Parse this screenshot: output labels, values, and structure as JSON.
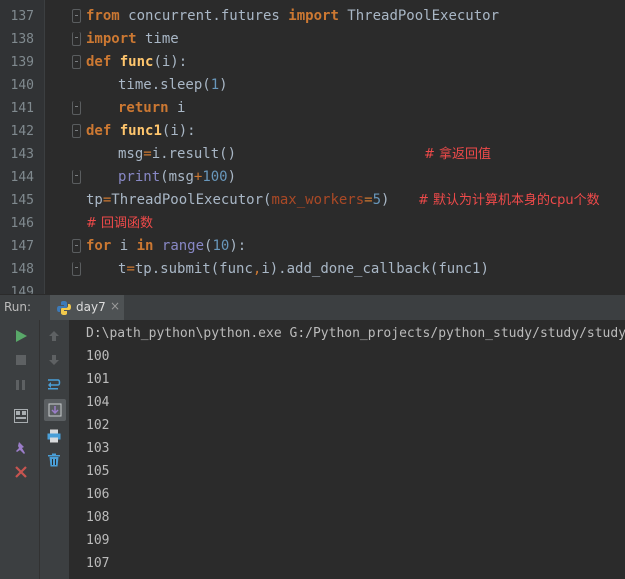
{
  "editor": {
    "lines": [
      {
        "num": "137"
      },
      {
        "num": "138"
      },
      {
        "num": "139"
      },
      {
        "num": "140"
      },
      {
        "num": "141"
      },
      {
        "num": "142"
      },
      {
        "num": "143"
      },
      {
        "num": "144"
      },
      {
        "num": "145"
      },
      {
        "num": "146"
      },
      {
        "num": "147"
      },
      {
        "num": "148"
      },
      {
        "num": "149"
      }
    ],
    "tokens": {
      "l137": [
        "from",
        " concurrent.futures ",
        "import",
        " ThreadPoolExecutor"
      ],
      "l138": [
        "import",
        " time"
      ],
      "l139": [
        "def",
        " ",
        "func",
        "(i):"
      ],
      "l140": [
        "time.sleep(",
        "1",
        ")"
      ],
      "l141": [
        "return",
        " i"
      ],
      "l142": [
        "def",
        " ",
        "func1",
        "(i):"
      ],
      "l143": [
        "msg",
        "=",
        "i.result()",
        "# 拿返回值"
      ],
      "l144": [
        "print",
        "(msg",
        "+",
        "100",
        ")"
      ],
      "l145": [
        "tp",
        "=",
        "ThreadPoolExecutor(",
        "max_workers",
        "=",
        "5",
        ")",
        "# 默认为计算机本身的cpu个数"
      ],
      "l146": [
        "# 回调函数"
      ],
      "l147": [
        "for",
        " i ",
        "in",
        " ",
        "range",
        "(",
        "10",
        "):"
      ],
      "l148": [
        "t",
        "=",
        "tp.submit(func",
        ",",
        "i).add_done_callback(func1)"
      ]
    }
  },
  "run": {
    "label": "Run:",
    "tab_name": "day7",
    "tab_close": "×"
  },
  "console": {
    "command": "D:\\path_python\\python.exe G:/Python_projects/python_study/study/study",
    "outputs": [
      "100",
      "101",
      "104",
      "102",
      "103",
      "105",
      "106",
      "108",
      "109",
      "107"
    ]
  },
  "colors": {
    "keyword": "#cc7832",
    "function": "#ffc66d",
    "number": "#6897bb",
    "builtin": "#8888c6",
    "comment": "#ef4a4a",
    "run_green": "#59a869",
    "close_red": "#c75450"
  },
  "icons": {
    "run": "run-icon",
    "stop": "stop-icon",
    "pause": "pause-icon",
    "up": "arrow-up-icon",
    "down": "arrow-down-icon",
    "soft_wrap": "soft-wrap-icon",
    "scroll_end": "scroll-to-end-icon",
    "print": "print-icon",
    "trash": "trash-icon",
    "layout": "layout-icon",
    "pin": "pin-icon",
    "close": "close-icon"
  }
}
